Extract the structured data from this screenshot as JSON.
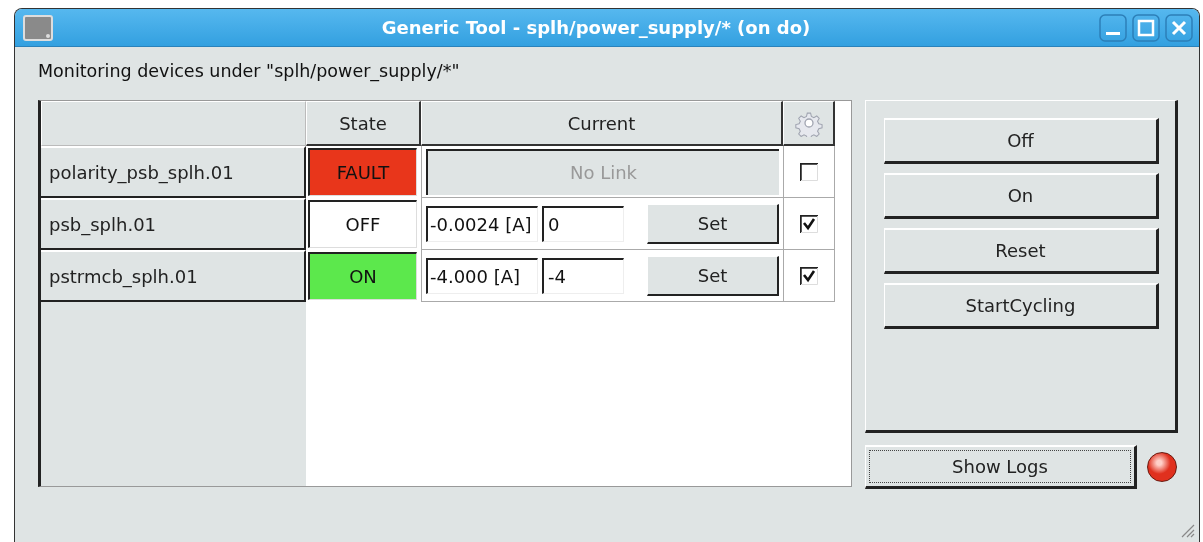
{
  "window": {
    "title": "Generic Tool - splh/power_supply/* (on do)"
  },
  "caption": "Monitoring devices under \"splh/power_supply/*\"",
  "table": {
    "columns": [
      "State",
      "Current"
    ],
    "rows": [
      {
        "kind": "nolink",
        "device": "polarity_psb_splh.01",
        "state": "FAULT",
        "color": "#e8361b",
        "current": "No Link",
        "enabled": false
      },
      {
        "kind": "control",
        "device": "psb_splh.01",
        "state": "OFF",
        "color": "#ffffff",
        "reading": "-0.0024 [A]",
        "setpoint": "0",
        "set_label": "Set",
        "enabled": true
      },
      {
        "kind": "control",
        "device": "pstrmcb_splh.01",
        "state": "ON",
        "color": "#5ce84c",
        "reading": "-4.000 [A]",
        "setpoint": "-4",
        "set_label": "Set",
        "enabled": true
      }
    ]
  },
  "actions": [
    "Off",
    "On",
    "Reset",
    "StartCycling"
  ],
  "show_logs": "Show Logs",
  "log_indicator": {
    "color": "#e0301e"
  }
}
